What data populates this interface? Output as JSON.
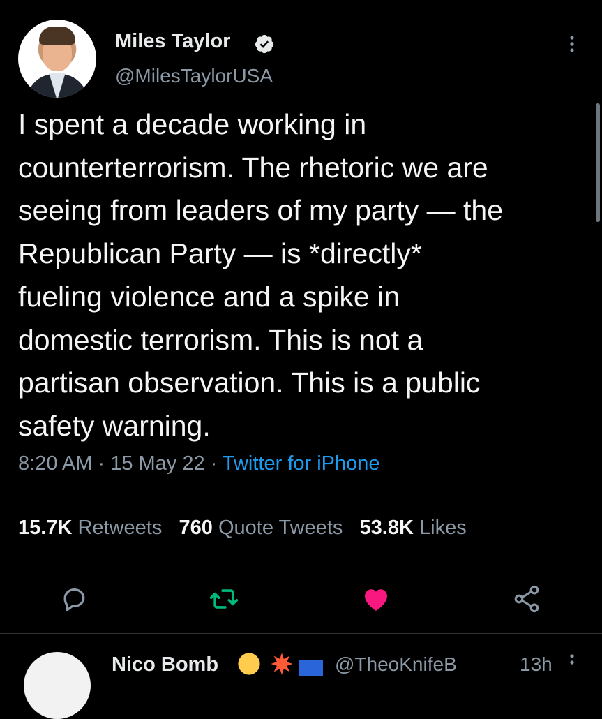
{
  "tweet": {
    "author_name": "Miles Taylor",
    "handle": "@MilesTaylorUSA",
    "text_lines": [
      "I spent a decade working in",
      "counterterrorism. The rhetoric we are",
      "seeing from leaders of my party — the",
      "Republican Party — is *directly*",
      "fueling violence and a spike in",
      "domestic terrorism. This is not a",
      "partisan observation. This is a public",
      "safety warning."
    ],
    "time": "8:20 AM",
    "dot1": " · ",
    "date": "15 May 22",
    "dot2": " · ",
    "source": "Twitter for iPhone"
  },
  "stats": {
    "retweets_count": "15.7K",
    "retweets_label": "Retweets",
    "quotes_count": "760",
    "quotes_label": "Quote Tweets",
    "likes_count": "53.8K",
    "likes_label": "Likes"
  },
  "icons": {
    "verified": "verified-badge-icon",
    "more": "more-vertical-icon",
    "reply": "reply-icon",
    "retweet": "retweet-icon",
    "like": "heart-icon",
    "share": "share-icon"
  },
  "colors": {
    "background": "#000000",
    "text": "#e7e9ea",
    "secondary": "#8b98a5",
    "link": "#1d9bf0",
    "retweet_green": "#00ba7c",
    "like_pink": "#f91880"
  },
  "next_tweet": {
    "author_name": "Nico Bomb",
    "handle": "@TheoKnifeB",
    "time": "13h"
  }
}
